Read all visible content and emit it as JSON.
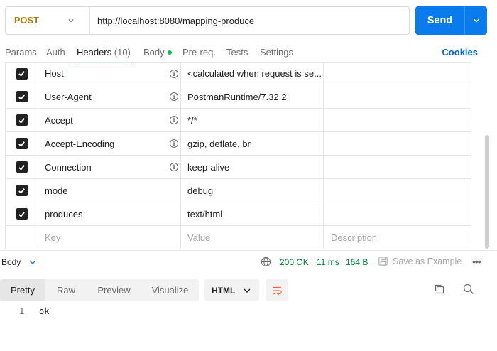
{
  "request": {
    "method": "POST",
    "url": "http://localhost:8080/mapping-produce",
    "send_label": "Send"
  },
  "tabs": {
    "params": "Params",
    "auth": "Auth",
    "headers": "Headers",
    "headers_count": "(10)",
    "body": "Body",
    "prereq": "Pre-req.",
    "tests": "Tests",
    "settings": "Settings",
    "cookies": "Cookies"
  },
  "headers": [
    {
      "key": "Host",
      "value": "<calculated when request is se...",
      "checked": true,
      "info": true
    },
    {
      "key": "User-Agent",
      "value": "PostmanRuntime/7.32.2",
      "checked": true,
      "info": true
    },
    {
      "key": "Accept",
      "value": "*/*",
      "checked": true,
      "info": true
    },
    {
      "key": "Accept-Encoding",
      "value": "gzip, deflate, br",
      "checked": true,
      "info": true
    },
    {
      "key": "Connection",
      "value": "keep-alive",
      "checked": true,
      "info": true
    },
    {
      "key": "mode",
      "value": "debug",
      "checked": true,
      "info": false
    },
    {
      "key": "produces",
      "value": "text/html",
      "checked": true,
      "info": false
    }
  ],
  "new_row": {
    "key_placeholder": "Key",
    "value_placeholder": "Value",
    "description_placeholder": "Description"
  },
  "response": {
    "body_label": "Body",
    "status": "200 OK",
    "time": "11 ms",
    "size": "164 B",
    "save_example": "Save as Example",
    "view_tabs": [
      "Pretty",
      "Raw",
      "Preview",
      "Visualize"
    ],
    "active_view": "Pretty",
    "format": "HTML",
    "lines": [
      {
        "no": "1",
        "text": "ok"
      }
    ]
  },
  "colors": {
    "accent": "#ff6c37",
    "send": "#097bed",
    "method": "#ad7a03",
    "status_ok": "#007f31",
    "link": "#0265d2"
  }
}
